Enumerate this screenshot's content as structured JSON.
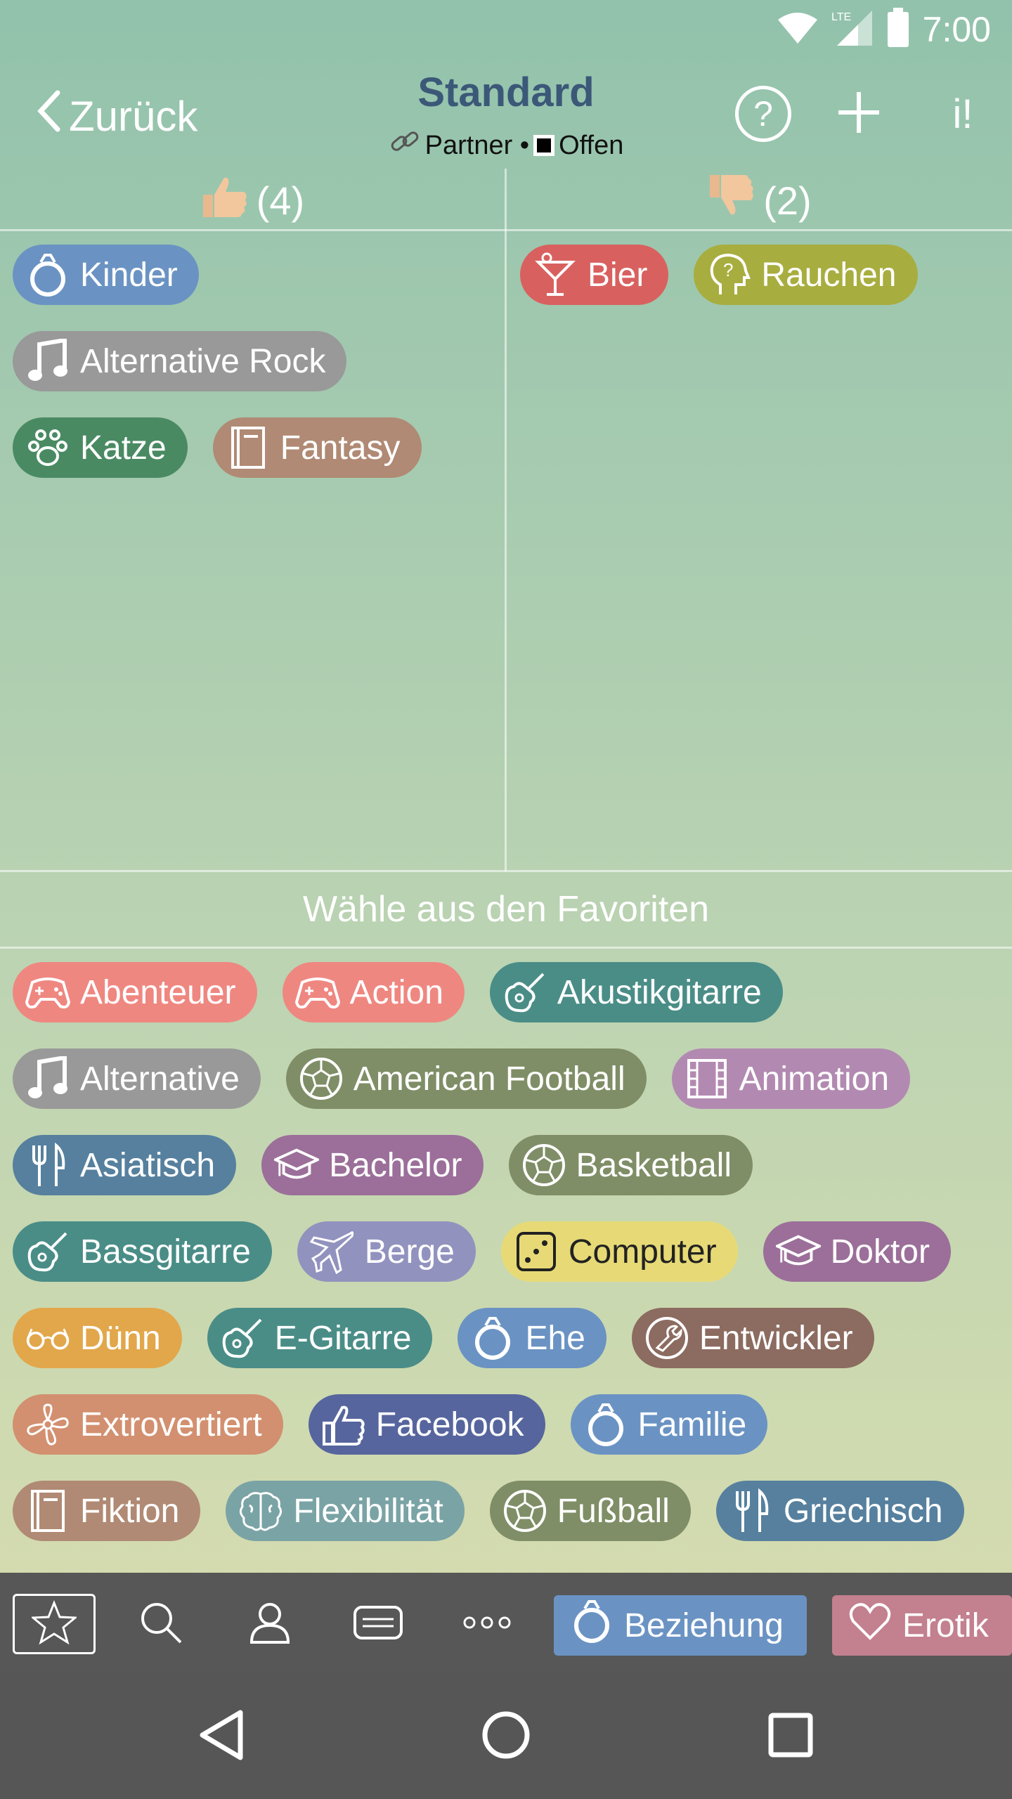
{
  "status": {
    "time": "7:00",
    "network": "LTE"
  },
  "header": {
    "back_label": "Zurück",
    "title": "Standard",
    "sub_partner": "Partner •",
    "sub_open": "Offen",
    "help_label": "?",
    "info_label": "i!"
  },
  "columns": {
    "likes_count": "(4)",
    "dislikes_count": "(2)"
  },
  "likes": [
    {
      "label": "Kinder",
      "icon": "ring-icon",
      "color": "#6a93c3"
    },
    {
      "label": "Alternative Rock",
      "icon": "music-note-icon",
      "color": "#999999"
    },
    {
      "label": "Katze",
      "icon": "paw-icon",
      "color": "#4a8a63"
    },
    {
      "label": "Fantasy",
      "icon": "book-icon",
      "color": "#b08a74"
    }
  ],
  "dislikes": [
    {
      "label": "Bier",
      "icon": "cocktail-icon",
      "color": "#d8615f"
    },
    {
      "label": "Rauchen",
      "icon": "head-question-icon",
      "color": "#a8ad3f"
    }
  ],
  "favorites_title": "Wähle aus den Favoriten",
  "favorites": [
    {
      "label": "Abenteuer",
      "icon": "gamepad-icon",
      "color": "#ef8781"
    },
    {
      "label": "Action",
      "icon": "gamepad-icon",
      "color": "#ef8781"
    },
    {
      "label": "Akustikgitarre",
      "icon": "guitar-icon",
      "color": "#4a8d87"
    },
    {
      "label": "Alternative",
      "icon": "music-note-icon",
      "color": "#999999"
    },
    {
      "label": "American Football",
      "icon": "ball-icon",
      "color": "#7f8e66"
    },
    {
      "label": "Animation",
      "icon": "film-icon",
      "color": "#b28ab1"
    },
    {
      "label": "Asiatisch",
      "icon": "cutlery-icon",
      "color": "#56809e"
    },
    {
      "label": "Bachelor",
      "icon": "graduation-cap-icon",
      "color": "#9b6f99"
    },
    {
      "label": "Basketball",
      "icon": "ball-icon",
      "color": "#7f8e66"
    },
    {
      "label": "Bassgitarre",
      "icon": "guitar-icon",
      "color": "#4a8d87"
    },
    {
      "label": "Berge",
      "icon": "plane-icon",
      "color": "#9292bf"
    },
    {
      "label": "Computer",
      "icon": "dice-icon",
      "color": "#e7da76"
    },
    {
      "label": "Doktor",
      "icon": "graduation-cap-icon",
      "color": "#9b6f99"
    },
    {
      "label": "Dünn",
      "icon": "glasses-icon",
      "color": "#e2a74b"
    },
    {
      "label": "E-Gitarre",
      "icon": "guitar-icon",
      "color": "#4a8d87"
    },
    {
      "label": "Ehe",
      "icon": "ring-icon",
      "color": "#6a93c3"
    },
    {
      "label": "Entwickler",
      "icon": "wrench-icon",
      "color": "#8c6b60"
    },
    {
      "label": "Extrovertiert",
      "icon": "flower-icon",
      "color": "#d29070"
    },
    {
      "label": "Facebook",
      "icon": "thumbs-up-icon",
      "color": "#56659d"
    },
    {
      "label": "Familie",
      "icon": "ring-icon",
      "color": "#6a93c3"
    },
    {
      "label": "Fiktion",
      "icon": "book-icon",
      "color": "#b08a74"
    },
    {
      "label": "Flexibilität",
      "icon": "brain-icon",
      "color": "#7aa3a5"
    },
    {
      "label": "Fußball",
      "icon": "ball-icon",
      "color": "#7f8e66"
    },
    {
      "label": "Griechisch",
      "icon": "cutlery-icon",
      "color": "#56809e"
    }
  ],
  "bottom_nav": {
    "items": [
      "star-icon",
      "search-icon",
      "person-icon",
      "chat-icon",
      "more-icon"
    ],
    "cat1_label": "Beziehung",
    "cat1_color": "#6a93c3",
    "cat2_label": "Erotik",
    "cat2_color": "#c3808f"
  }
}
